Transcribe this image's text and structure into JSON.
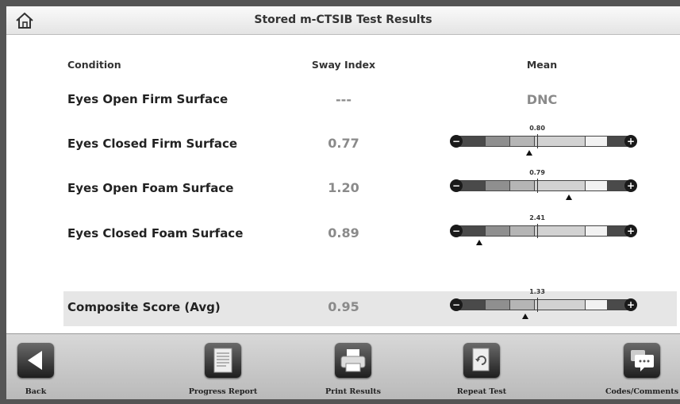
{
  "header": {
    "title": "Stored m-CTSIB Test Results",
    "home_icon": "home-icon"
  },
  "table": {
    "columns": [
      "Condition",
      "Sway Index",
      "Mean"
    ],
    "rows": [
      {
        "condition": "Eyes Open Firm Surface",
        "sway_index": "---",
        "mean_text": "DNC"
      },
      {
        "condition": "Eyes Closed Firm Surface",
        "sway_index": "0.77",
        "mean_label": "0.80",
        "mean_fraction": 0.464,
        "marker_fraction": 0.42
      },
      {
        "condition": "Eyes Open Foam Surface",
        "sway_index": "1.20",
        "mean_label": "0.79",
        "mean_fraction": 0.464,
        "marker_fraction": 0.647
      },
      {
        "condition": "Eyes Closed Foam Surface",
        "sway_index": "0.89",
        "mean_label": "2.41",
        "mean_fraction": 0.464,
        "marker_fraction": 0.13
      }
    ],
    "composite": {
      "condition": "Composite Score (Avg)",
      "sway_index": "0.95",
      "mean_label": "1.33",
      "mean_fraction": 0.464,
      "marker_fraction": 0.397
    }
  },
  "gauge_colors": [
    "#4a4a4a",
    "#8f8f8f",
    "#b5b5b5",
    "#d2d2d2",
    "#f2f2f2",
    "#4a4a4a"
  ],
  "toolbar": {
    "back": "Back",
    "progress_report": "Progress Report",
    "print_results": "Print Results",
    "repeat_test": "Repeat Test",
    "codes_comments": "Codes/Comments"
  }
}
